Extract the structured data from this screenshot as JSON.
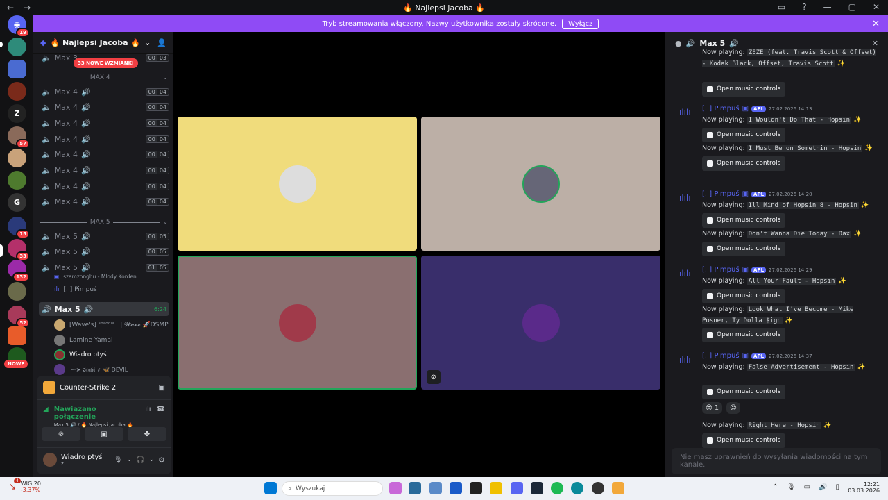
{
  "window": {
    "title": "🔥 Najlepsi Jacoba 🔥"
  },
  "banner": {
    "text": "Tryb streamowania włączony. Nazwy użytkownika zostały skrócone.",
    "button": "Wyłącz"
  },
  "guilds": {
    "badges": [
      "19",
      "57",
      "15",
      "33",
      "132",
      "52"
    ],
    "letter": "Z",
    "new_label": "NOWE"
  },
  "server": {
    "name": "🔥 Najlepsi Jacoba 🔥",
    "mentions": "33 NOWE WZMIANKI"
  },
  "channels": {
    "top": {
      "name": "Max 3",
      "a": "00",
      "b": "03"
    },
    "cat4": "MAX 4",
    "cat5": "MAX 5",
    "max4": [
      {
        "name": "Max 4",
        "a": "00",
        "b": "04"
      },
      {
        "name": "Max 4",
        "a": "00",
        "b": "04"
      },
      {
        "name": "Max 4",
        "a": "00",
        "b": "04"
      },
      {
        "name": "Max 4",
        "a": "00",
        "b": "04"
      },
      {
        "name": "Max 4",
        "a": "00",
        "b": "04"
      },
      {
        "name": "Max 4",
        "a": "00",
        "b": "04"
      },
      {
        "name": "Max 4",
        "a": "00",
        "b": "04"
      },
      {
        "name": "Max 4",
        "a": "00",
        "b": "04"
      }
    ],
    "max5": [
      {
        "name": "Max 5",
        "a": "00",
        "b": "05"
      },
      {
        "name": "Max 5",
        "a": "00",
        "b": "05"
      },
      {
        "name": "Max 5",
        "a": "01",
        "b": "05"
      }
    ],
    "activity": "szamzonghu - Mlody Korden",
    "sub_user": "[. ] Pimpuś",
    "active": {
      "name": "Max 5",
      "time": "6:24"
    },
    "members": [
      "[Wave's] ˢʰᵃᵈᵒʷ ||| 𝓦𝓪𝓿𝓮 🚀DSMP",
      "Lamine Yamal",
      "Wiadro ptyś",
      "╰┈➤ 𝕴𝖗𝖆𝖇𝖎 ⸙ 🦋 DEVIL"
    ]
  },
  "panel": {
    "game": "Counter-Strike 2",
    "status": "Nawiązano połączenie",
    "location": "Max 5 🔊 / 🔥 Najlepsi Jacoba 🔥",
    "username": "Wiadro ptyś",
    "user_sub": "z..."
  },
  "chat": {
    "header": "Max 5",
    "first_text": "Now playing:",
    "first_song": "ZEZE (feat. Travis Scott & Offset) - Kodak Black, Offset, Travis Scott",
    "controls": "Open music controls",
    "author": "[. ] Pimpuś",
    "apl": "APL",
    "groups": [
      {
        "time": "27.02.2026 14:13",
        "songs": [
          "I Wouldn't Do That - Hopsin",
          "I Must Be on Somethin - Hopsin"
        ]
      },
      {
        "time": "27.02.2026 14:20",
        "songs": [
          "Ill Mind of Hopsin 8 - Hopsin",
          "Don't Wanna Die Today - Dax"
        ]
      },
      {
        "time": "27.02.2026 14:29",
        "songs": [
          "All Your Fault - Hopsin",
          "Look What I've Become - Mike Posner, Ty Dolla $ign"
        ]
      },
      {
        "time": "27.02.2026 14:37",
        "songs": [
          "False Advertisement - Hopsin",
          "Right Here - Hopsin"
        ]
      }
    ],
    "reaction_count": "1",
    "now_playing": "Now playing:",
    "input_placeholder": "Nie masz uprawnień do wysyłania wiadomości na tym kanale."
  },
  "taskbar": {
    "stock": "WIG 20",
    "change": "-3,37%",
    "search": "Wyszukaj",
    "time": "12:21",
    "date": "03.03.2026",
    "notif": "4"
  },
  "colors": {
    "accent": "#8f4bf5",
    "blurple": "#5865f2",
    "green": "#23a55a"
  }
}
